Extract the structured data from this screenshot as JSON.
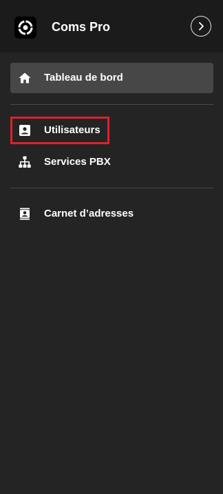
{
  "app": {
    "title": "Coms Pro",
    "logo_icon": "coms-pro-logo-icon",
    "expand_icon": "chevron-right-icon"
  },
  "nav": {
    "items": [
      {
        "label": "Tableau de bord",
        "icon": "home-icon",
        "active": true
      },
      {
        "label": "Utilisateurs",
        "icon": "user-badge-icon",
        "highlighted": true
      },
      {
        "label": "Services PBX",
        "icon": "sitemap-icon"
      },
      {
        "label": "Carnet d’adresses",
        "icon": "address-book-icon"
      }
    ]
  },
  "colors": {
    "background": "#242424",
    "header_background": "#1b1b1b",
    "active_item_background": "#474747",
    "highlight_border": "#e0202a",
    "divider": "#4a4a4a"
  }
}
